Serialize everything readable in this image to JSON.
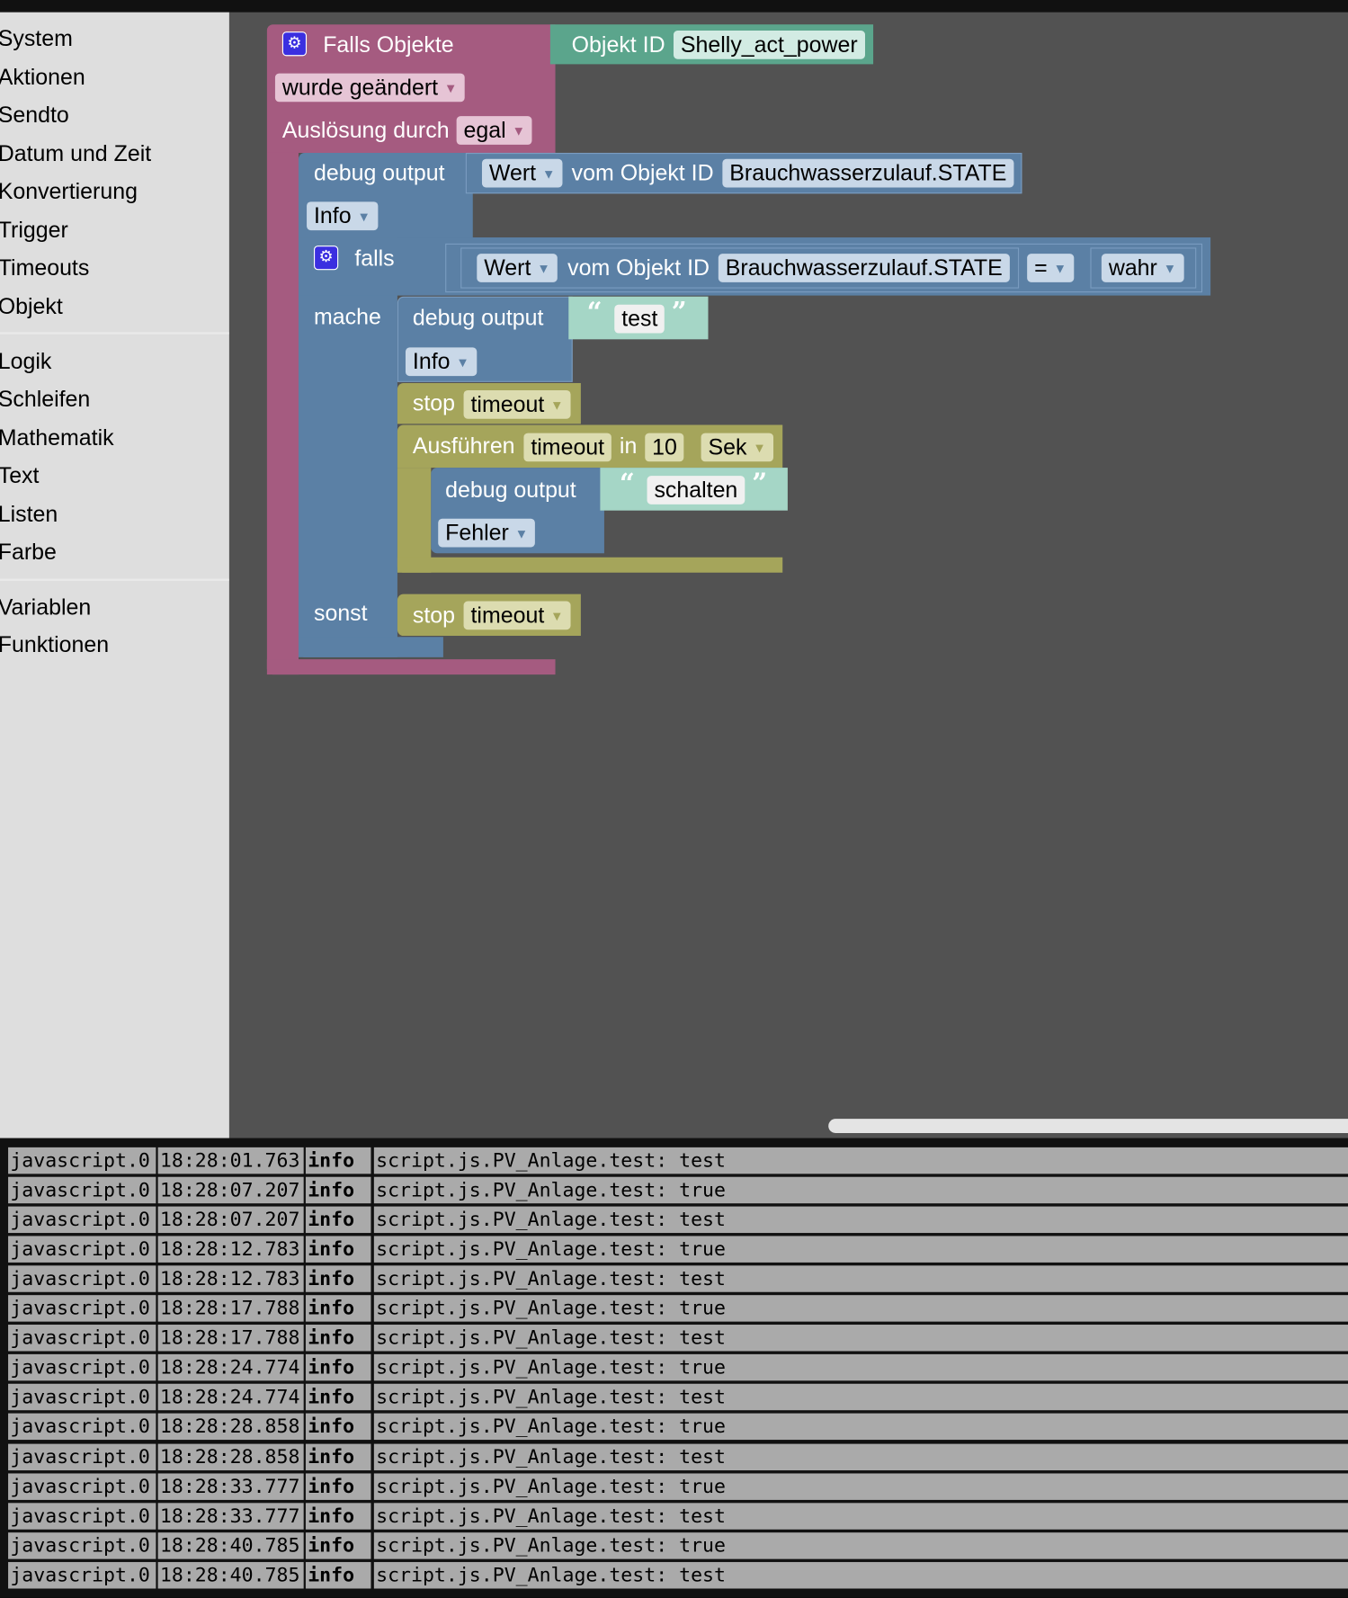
{
  "sidebar": {
    "groups": [
      [
        "System",
        "Aktionen",
        "Sendto",
        "Datum und Zeit",
        "Konvertierung",
        "Trigger",
        "Timeouts",
        "Objekt"
      ],
      [
        "Logik",
        "Schleifen",
        "Mathematik",
        "Text",
        "Listen",
        "Farbe"
      ],
      [
        "Variablen",
        "Funktionen"
      ]
    ]
  },
  "blocks": {
    "event": {
      "title": "Falls Objekte",
      "trigger": "wurde geändert",
      "source_label": "Auslösung durch",
      "source": "egal",
      "object_id_label": "Objekt ID",
      "object_id": "Shelly_act_power"
    },
    "debug1": {
      "label": "debug output",
      "value": "Wert",
      "from_label": "vom Objekt ID",
      "oid": "Brauchwasserzulauf.STATE",
      "level": "Info"
    },
    "if": {
      "label": "falls",
      "value": "Wert",
      "from_label": "vom Objekt ID",
      "oid": "Brauchwasserzulauf.STATE",
      "op": "=",
      "rhs": "wahr",
      "do_label": "mache",
      "else_label": "sonst"
    },
    "debug2": {
      "label": "debug output",
      "text": "test",
      "level": "Info"
    },
    "stop1": {
      "label": "stop",
      "name": "timeout"
    },
    "timeout": {
      "label": "Ausführen",
      "name": "timeout",
      "in_label": "in",
      "delay": "10",
      "unit": "Sek"
    },
    "debug3": {
      "label": "debug output",
      "text": "schalten",
      "level": "Fehler"
    },
    "stop2": {
      "label": "stop",
      "name": "timeout"
    },
    "colors": {
      "event": "#a55b80",
      "system": "#5b80a5",
      "timeouts": "#a5a55b",
      "object_id": "#5ba58c",
      "text": "#a5d6c6"
    }
  },
  "log": [
    [
      "javascript.0",
      "18:28:01.763",
      "info",
      "script.js.PV_Anlage.test: test"
    ],
    [
      "javascript.0",
      "18:28:07.207",
      "info",
      "script.js.PV_Anlage.test: true"
    ],
    [
      "javascript.0",
      "18:28:07.207",
      "info",
      "script.js.PV_Anlage.test: test"
    ],
    [
      "javascript.0",
      "18:28:12.783",
      "info",
      "script.js.PV_Anlage.test: true"
    ],
    [
      "javascript.0",
      "18:28:12.783",
      "info",
      "script.js.PV_Anlage.test: test"
    ],
    [
      "javascript.0",
      "18:28:17.788",
      "info",
      "script.js.PV_Anlage.test: true"
    ],
    [
      "javascript.0",
      "18:28:17.788",
      "info",
      "script.js.PV_Anlage.test: test"
    ],
    [
      "javascript.0",
      "18:28:24.774",
      "info",
      "script.js.PV_Anlage.test: true"
    ],
    [
      "javascript.0",
      "18:28:24.774",
      "info",
      "script.js.PV_Anlage.test: test"
    ],
    [
      "javascript.0",
      "18:28:28.858",
      "info",
      "script.js.PV_Anlage.test: true"
    ],
    [
      "javascript.0",
      "18:28:28.858",
      "info",
      "script.js.PV_Anlage.test: test"
    ],
    [
      "javascript.0",
      "18:28:33.777",
      "info",
      "script.js.PV_Anlage.test: true"
    ],
    [
      "javascript.0",
      "18:28:33.777",
      "info",
      "script.js.PV_Anlage.test: test"
    ],
    [
      "javascript.0",
      "18:28:40.785",
      "info",
      "script.js.PV_Anlage.test: true"
    ],
    [
      "javascript.0",
      "18:28:40.785",
      "info",
      "script.js.PV_Anlage.test: test"
    ]
  ]
}
